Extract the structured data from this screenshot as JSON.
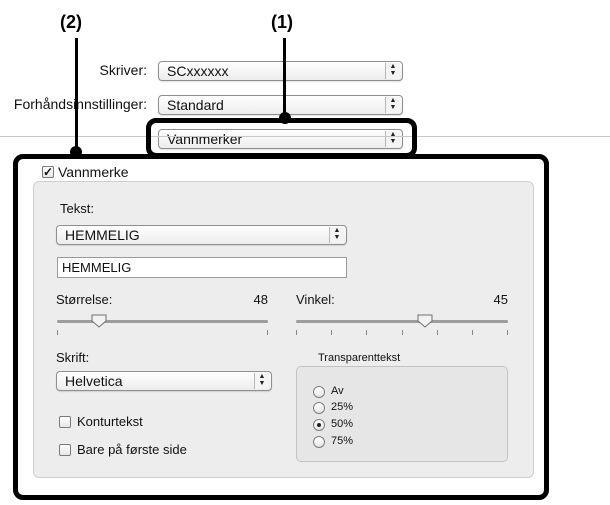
{
  "callouts": {
    "one": "(1)",
    "two": "(2)"
  },
  "printer": {
    "label": "Skriver:",
    "value": "SCxxxxxx"
  },
  "presets": {
    "label": "Forhåndsinnstillinger:",
    "value": "Standard"
  },
  "panel_menu": {
    "value": "Vannmerker"
  },
  "watermark": {
    "checkbox_label": "Vannmerke",
    "checked": true,
    "text_label": "Tekst:",
    "text_select": "HEMMELIG",
    "text_value": "HEMMELIG",
    "size_label": "Størrelse:",
    "size_value": "48",
    "size_level": 0.2,
    "angle_label": "Vinkel:",
    "angle_value": "45",
    "angle_level": 0.61,
    "font_label": "Skrift:",
    "font_value": "Helvetica",
    "outline_label": "Konturtekst",
    "outline_checked": false,
    "first_page_label": "Bare på første side",
    "first_page_checked": false,
    "transparency": {
      "label": "Transparenttekst",
      "options": [
        {
          "label": "Av",
          "selected": false
        },
        {
          "label": "25%",
          "selected": false
        },
        {
          "label": "50%",
          "selected": true
        },
        {
          "label": "75%",
          "selected": false
        }
      ]
    }
  }
}
